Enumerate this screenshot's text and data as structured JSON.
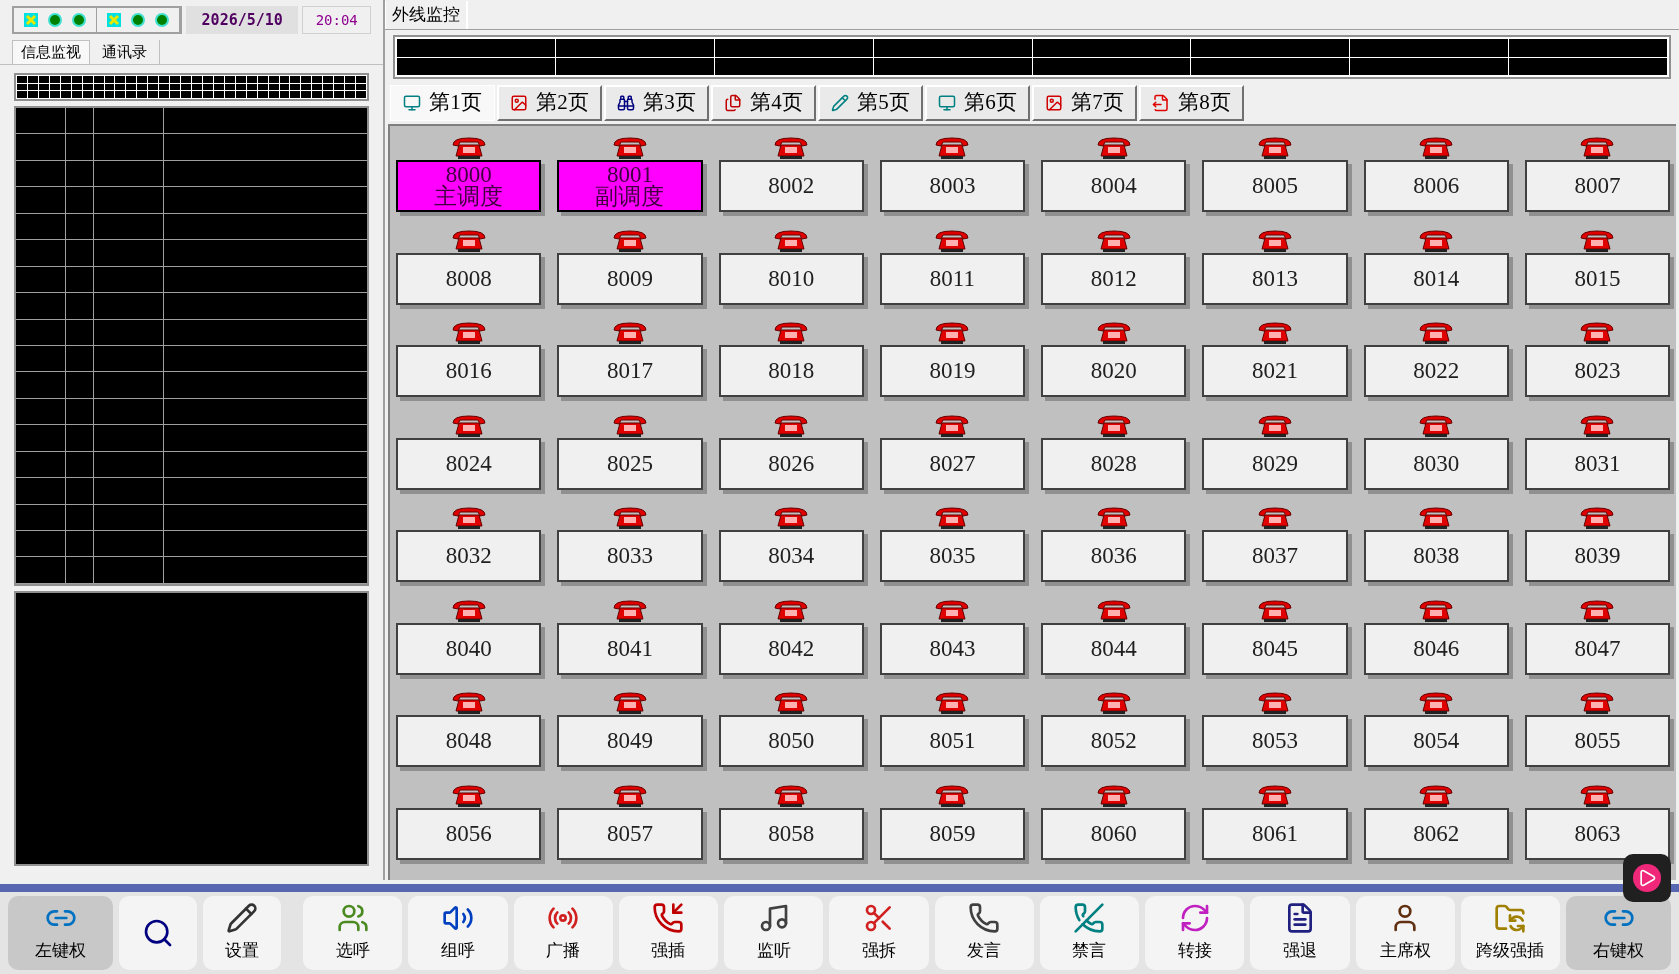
{
  "status_bar": {
    "indicator_groups": [
      [
        {
          "kind": "alarm"
        },
        {
          "kind": "ok"
        },
        {
          "kind": "ok"
        }
      ],
      [
        {
          "kind": "alarm"
        },
        {
          "kind": "ok"
        },
        {
          "kind": "ok"
        }
      ]
    ],
    "date": "2026/5/10",
    "time": "20:04"
  },
  "left_tabs": [
    {
      "label": "信息监视",
      "selected": true
    },
    {
      "label": "通讯录",
      "selected": false
    }
  ],
  "trunk_tabs": [
    {
      "label": "外线监控",
      "selected": true
    }
  ],
  "page_tabs": [
    {
      "label": "第1页",
      "selected": true
    },
    {
      "label": "第2页",
      "selected": false
    },
    {
      "label": "第3页",
      "selected": false
    },
    {
      "label": "第4页",
      "selected": false
    },
    {
      "label": "第5页",
      "selected": false
    },
    {
      "label": "第6页",
      "selected": false
    },
    {
      "label": "第7页",
      "selected": false
    },
    {
      "label": "第8页",
      "selected": false
    }
  ],
  "extensions": [
    {
      "number": "8000",
      "name": "主调度",
      "highlighted": true
    },
    {
      "number": "8001",
      "name": "副调度",
      "highlighted": true
    },
    {
      "number": "8002",
      "highlighted": false
    },
    {
      "number": "8003",
      "highlighted": false
    },
    {
      "number": "8004",
      "highlighted": false
    },
    {
      "number": "8005",
      "highlighted": false
    },
    {
      "number": "8006",
      "highlighted": false
    },
    {
      "number": "8007",
      "highlighted": false
    },
    {
      "number": "8008",
      "highlighted": false
    },
    {
      "number": "8009",
      "highlighted": false
    },
    {
      "number": "8010",
      "highlighted": false
    },
    {
      "number": "8011",
      "highlighted": false
    },
    {
      "number": "8012",
      "highlighted": false
    },
    {
      "number": "8013",
      "highlighted": false
    },
    {
      "number": "8014",
      "highlighted": false
    },
    {
      "number": "8015",
      "highlighted": false
    },
    {
      "number": "8016",
      "highlighted": false
    },
    {
      "number": "8017",
      "highlighted": false
    },
    {
      "number": "8018",
      "highlighted": false
    },
    {
      "number": "8019",
      "highlighted": false
    },
    {
      "number": "8020",
      "highlighted": false
    },
    {
      "number": "8021",
      "highlighted": false
    },
    {
      "number": "8022",
      "highlighted": false
    },
    {
      "number": "8023",
      "highlighted": false
    },
    {
      "number": "8024",
      "highlighted": false
    },
    {
      "number": "8025",
      "highlighted": false
    },
    {
      "number": "8026",
      "highlighted": false
    },
    {
      "number": "8027",
      "highlighted": false
    },
    {
      "number": "8028",
      "highlighted": false
    },
    {
      "number": "8029",
      "highlighted": false
    },
    {
      "number": "8030",
      "highlighted": false
    },
    {
      "number": "8031",
      "highlighted": false
    },
    {
      "number": "8032",
      "highlighted": false
    },
    {
      "number": "8033",
      "highlighted": false
    },
    {
      "number": "8034",
      "highlighted": false
    },
    {
      "number": "8035",
      "highlighted": false
    },
    {
      "number": "8036",
      "highlighted": false
    },
    {
      "number": "8037",
      "highlighted": false
    },
    {
      "number": "8038",
      "highlighted": false
    },
    {
      "number": "8039",
      "highlighted": false
    },
    {
      "number": "8040",
      "highlighted": false
    },
    {
      "number": "8041",
      "highlighted": false
    },
    {
      "number": "8042",
      "highlighted": false
    },
    {
      "number": "8043",
      "highlighted": false
    },
    {
      "number": "8044",
      "highlighted": false
    },
    {
      "number": "8045",
      "highlighted": false
    },
    {
      "number": "8046",
      "highlighted": false
    },
    {
      "number": "8047",
      "highlighted": false
    },
    {
      "number": "8048",
      "highlighted": false
    },
    {
      "number": "8049",
      "highlighted": false
    },
    {
      "number": "8050",
      "highlighted": false
    },
    {
      "number": "8051",
      "highlighted": false
    },
    {
      "number": "8052",
      "highlighted": false
    },
    {
      "number": "8053",
      "highlighted": false
    },
    {
      "number": "8054",
      "highlighted": false
    },
    {
      "number": "8055",
      "highlighted": false
    },
    {
      "number": "8056",
      "highlighted": false
    },
    {
      "number": "8057",
      "highlighted": false
    },
    {
      "number": "8058",
      "highlighted": false
    },
    {
      "number": "8059",
      "highlighted": false
    },
    {
      "number": "8060",
      "highlighted": false
    },
    {
      "number": "8061",
      "highlighted": false
    },
    {
      "number": "8062",
      "highlighted": false
    },
    {
      "number": "8063",
      "highlighted": false
    }
  ],
  "toolbar": [
    {
      "label": "左键权",
      "selected": true
    },
    {
      "selected": false
    },
    {
      "label": "设置",
      "selected": false
    },
    {
      "label": "选呼",
      "selected": false
    },
    {
      "label": "组呼",
      "selected": false
    },
    {
      "label": "广播",
      "selected": false
    },
    {
      "label": "强插",
      "selected": false
    },
    {
      "label": "监听",
      "selected": false
    },
    {
      "label": "强拆",
      "selected": false
    },
    {
      "label": "发言",
      "selected": false
    },
    {
      "label": "禁言",
      "selected": false
    },
    {
      "label": "转接",
      "selected": false
    },
    {
      "label": "强退",
      "selected": false
    },
    {
      "label": "主席权",
      "selected": false
    },
    {
      "label": "跨级强插",
      "selected": false
    },
    {
      "label": "右键权",
      "selected": true
    }
  ]
}
